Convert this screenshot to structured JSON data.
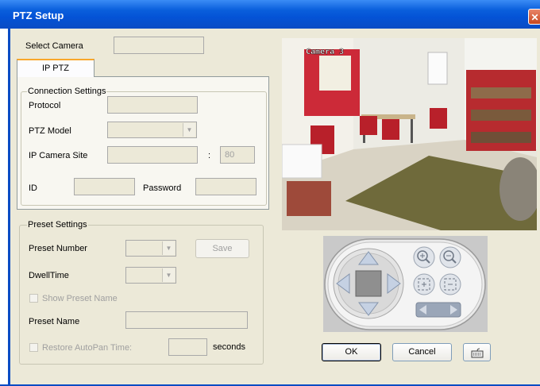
{
  "window": {
    "title": "PTZ Setup",
    "close": "✕"
  },
  "select_camera": {
    "label": "Select Camera",
    "value": ""
  },
  "tab": {
    "label": "IP PTZ"
  },
  "connection": {
    "title": "Connection Settings",
    "protocol_label": "Protocol",
    "protocol_value": "",
    "model_label": "PTZ Model",
    "model_value": "",
    "site_label": "IP Camera Site",
    "site_value": "",
    "colon": ":",
    "port_value": "80",
    "id_label": "ID",
    "id_value": "",
    "password_label": "Password",
    "password_value": ""
  },
  "preset": {
    "title": "Preset Settings",
    "number_label": "Preset Number",
    "number_value": "",
    "save_label": "Save",
    "dwell_label": "DwellTime",
    "dwell_value": "",
    "show_name_label": "Show Preset Name",
    "name_label": "Preset Name",
    "name_value": "",
    "autopan_label": "Restore AutoPan Time:",
    "autopan_value": "",
    "seconds_label": "seconds"
  },
  "camera": {
    "overlay": "Camera 3"
  },
  "buttons": {
    "ok": "OK",
    "cancel": "Cancel"
  },
  "icons": {
    "zoom_in": "zoom-in-icon",
    "zoom_out": "zoom-out-icon",
    "focus_near": "focus-near-icon",
    "focus_far": "focus-far-icon",
    "keyboard": "keyboard-icon"
  },
  "colors": {
    "title_bar": "#0a4cc4",
    "dialog_bg": "#ece9d8",
    "tab_accent": "#f9a72b"
  }
}
